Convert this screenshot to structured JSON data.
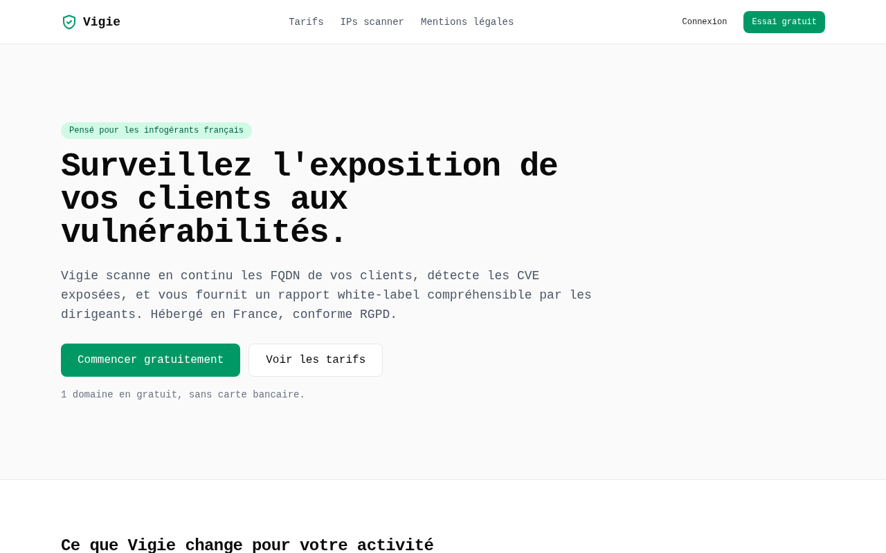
{
  "header": {
    "logo": "Vigie",
    "nav": [
      {
        "label": "Tarifs"
      },
      {
        "label": "IPs scanner"
      },
      {
        "label": "Mentions légales"
      }
    ],
    "actions": [
      {
        "label": "Connexion",
        "kind": "ghost"
      },
      {
        "label": "Essai gratuit",
        "kind": "primary"
      }
    ]
  },
  "hero": {
    "badge": "Pensé pour les infogérants français",
    "title": "Surveillez l'exposition de vos clients aux vulnérabilités.",
    "description": "Vigie scanne en continu les FQDN de vos clients, détecte les CVE exposées, et vous fournit un rapport white-label compréhensible par les dirigeants. Hébergé en France, conforme RGPD.",
    "buttons": [
      {
        "label": "Commencer gratuitement",
        "kind": "primary"
      },
      {
        "label": "Voir les tarifs",
        "kind": "secondary"
      }
    ],
    "note": "1 domaine en gratuit, sans carte bancaire."
  },
  "features": {
    "title": "Ce que Vigie change pour votre activité"
  }
}
